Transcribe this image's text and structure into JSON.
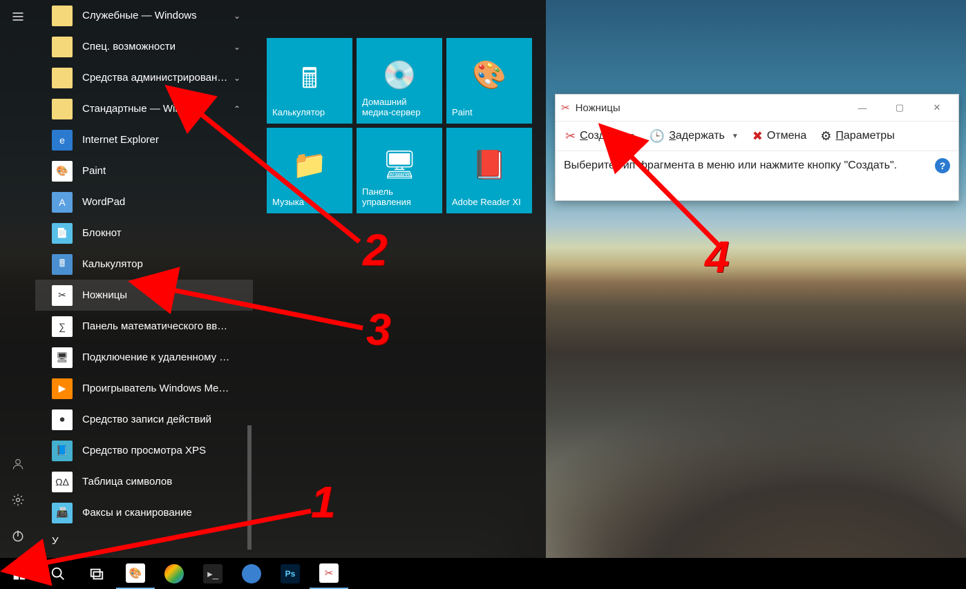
{
  "start_menu": {
    "folders": [
      {
        "label": "Служебные — Windows",
        "expanded": false
      },
      {
        "label": "Спец. возможности",
        "expanded": false
      },
      {
        "label": "Средства администрировани…",
        "expanded": false
      },
      {
        "label": "Стандартные — Windows",
        "expanded": true
      }
    ],
    "apps": [
      {
        "label": "Internet Explorer",
        "icon": "ie"
      },
      {
        "label": "Paint",
        "icon": "paint"
      },
      {
        "label": "WordPad",
        "icon": "wordpad"
      },
      {
        "label": "Блокнот",
        "icon": "notepad"
      },
      {
        "label": "Калькулятор",
        "icon": "calc"
      },
      {
        "label": "Ножницы",
        "icon": "snip",
        "highlighted": true
      },
      {
        "label": "Панель математического ввода",
        "icon": "math"
      },
      {
        "label": "Подключение к удаленному ра…",
        "icon": "rdp"
      },
      {
        "label": "Проигрыватель Windows Media",
        "icon": "wmp"
      },
      {
        "label": "Средство записи действий",
        "icon": "psr"
      },
      {
        "label": "Средство просмотра XPS",
        "icon": "xps"
      },
      {
        "label": "Таблица символов",
        "icon": "charmap"
      },
      {
        "label": "Факсы и сканирование",
        "icon": "fax"
      }
    ],
    "letter": "У",
    "tiles": [
      {
        "label": "Калькулятор"
      },
      {
        "label": "Домашний медиа-сервер"
      },
      {
        "label": "Paint"
      },
      {
        "label": "Музыка"
      },
      {
        "label": "Панель управления"
      },
      {
        "label": "Adobe Reader XI"
      }
    ]
  },
  "snip": {
    "title": "Ножницы",
    "toolbar": {
      "create": "Создать",
      "delay": "Задержать",
      "cancel": "Отмена",
      "params": "Параметры"
    },
    "body": "Выберите тип фрагмента в меню или нажмите кнопку \"Создать\"."
  },
  "annotations": {
    "n1": "1",
    "n2": "2",
    "n3": "3",
    "n4": "4"
  },
  "app_icons": {
    "ie": {
      "bg": "#2a7ad0",
      "glyph": "e"
    },
    "paint": {
      "bg": "#fff",
      "glyph": "🎨"
    },
    "wordpad": {
      "bg": "#5aa0e0",
      "glyph": "A"
    },
    "notepad": {
      "bg": "#58c0e8",
      "glyph": "📄"
    },
    "calc": {
      "bg": "#4a90d0",
      "glyph": "🖩"
    },
    "snip": {
      "bg": "#fff",
      "glyph": "✂"
    },
    "math": {
      "bg": "#fff",
      "glyph": "∑"
    },
    "rdp": {
      "bg": "#fff",
      "glyph": "🖥"
    },
    "wmp": {
      "bg": "#ff8800",
      "glyph": "▶"
    },
    "psr": {
      "bg": "#fff",
      "glyph": "⏺"
    },
    "xps": {
      "bg": "#45b0d0",
      "glyph": "📘"
    },
    "charmap": {
      "bg": "#fff",
      "glyph": "ΩΔ"
    },
    "fax": {
      "bg": "#58c0e8",
      "glyph": "📠"
    }
  }
}
